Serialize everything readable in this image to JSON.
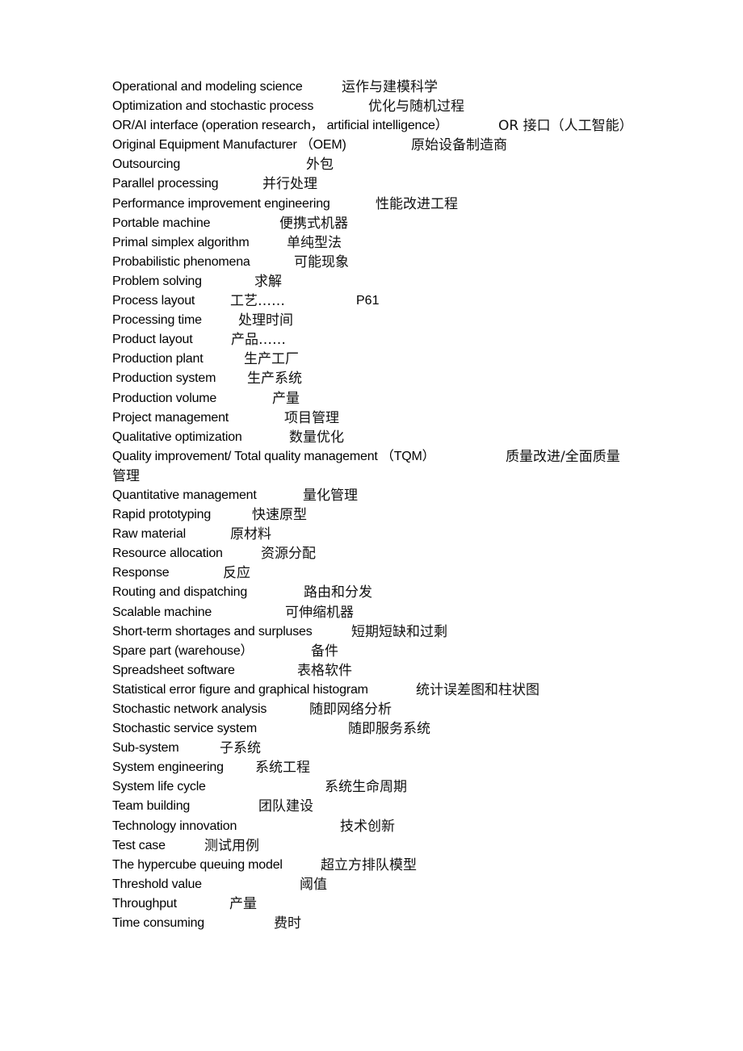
{
  "document": {
    "entries": [
      {
        "en": "Operational and modeling science",
        "zh": "运作与建模科学"
      },
      {
        "en": "Optimization and stochastic process",
        "zh": "优化与随机过程"
      },
      {
        "en": "OR/AI interface (operation research，  artificial intelligence）",
        "zh": "OR 接口（人工智能）"
      },
      {
        "en": "Original Equipment Manufacturer （OEM)",
        "zh": "原始设备制造商"
      },
      {
        "en": "Outsourcing",
        "zh": "外包"
      },
      {
        "en": "Parallel processing",
        "zh": "并行处理"
      },
      {
        "en": "Performance improvement engineering",
        "zh": "性能改进工程"
      },
      {
        "en": "Portable machine",
        "zh": "便携式机器"
      },
      {
        "en": "Primal simplex algorithm",
        "zh": "单纯型法"
      },
      {
        "en": "Probabilistic phenomena",
        "zh": "可能现象"
      },
      {
        "en": "Problem solving",
        "zh": "求解"
      },
      {
        "en": "Process layout",
        "zh": "工艺……",
        "extra": "P61"
      },
      {
        "en": "Processing time",
        "zh": "处理时间"
      },
      {
        "en": "Product layout",
        "zh": "产品……"
      },
      {
        "en": "Production plant",
        "zh": "生产工厂"
      },
      {
        "en": "Production system",
        "zh": "生产系统"
      },
      {
        "en": "Production volume",
        "zh": "产量"
      },
      {
        "en": "Project management",
        "zh": "项目管理"
      },
      {
        "en": "Qualitative optimization",
        "zh": "数量优化"
      },
      {
        "en": "Quality improvement/ Total quality management （TQM）",
        "zh": "质量改进/全面质量",
        "zh_cont": "管理"
      },
      {
        "en": "Quantitative management",
        "zh": "量化管理"
      },
      {
        "en": "Rapid prototyping",
        "zh": "快速原型"
      },
      {
        "en": "Raw material",
        "zh": "原材料"
      },
      {
        "en": "Resource allocation",
        "zh": "资源分配"
      },
      {
        "en": "Response",
        "zh": "反应"
      },
      {
        "en": "Routing and dispatching",
        "zh": "路由和分发"
      },
      {
        "en": "Scalable machine",
        "zh": "可伸缩机器"
      },
      {
        "en": "Short-term shortages and surpluses",
        "zh": "短期短缺和过剩"
      },
      {
        "en": "Spare part (warehouse）",
        "zh": "备件"
      },
      {
        "en": "Spreadsheet software",
        "zh": "表格软件"
      },
      {
        "en": "Statistical error figure and graphical histogram",
        "zh": "统计误差图和柱状图"
      },
      {
        "en": "Stochastic network analysis",
        "zh": "随即网络分析"
      },
      {
        "en": "Stochastic service system",
        "zh": "随即服务系统"
      },
      {
        "en": "Sub-system",
        "zh": "子系统"
      },
      {
        "en": "System engineering",
        "zh": "系统工程"
      },
      {
        "en": "System life cycle",
        "zh": "系统生命周期"
      },
      {
        "en": "Team building",
        "zh": "团队建设"
      },
      {
        "en": "Technology innovation",
        "zh": "技术创新"
      },
      {
        "en": "Test case",
        "zh": "测试用例"
      },
      {
        "en": "The hypercube queuing model",
        "zh": "超立方排队模型"
      },
      {
        "en": "Threshold value",
        "zh": "阈值"
      },
      {
        "en": "Throughput",
        "zh": "产量"
      },
      {
        "en": "Time consuming",
        "zh": "费时"
      }
    ]
  }
}
